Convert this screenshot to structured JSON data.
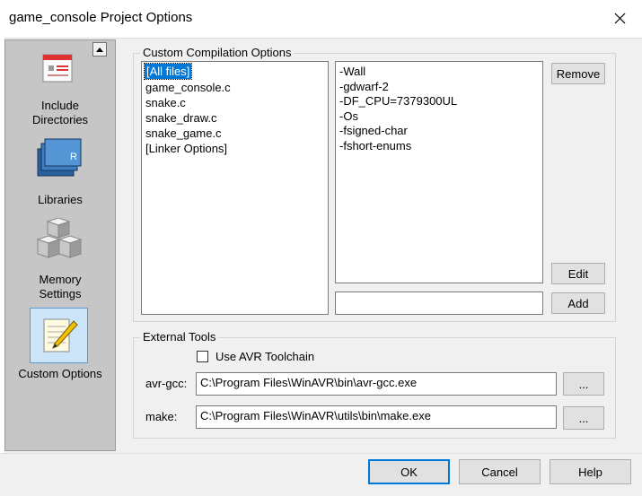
{
  "window": {
    "title": "game_console Project Options"
  },
  "sidebar": {
    "items": [
      {
        "label_line1": "Include",
        "label_line2": "Directories",
        "icon": "include-directories-icon"
      },
      {
        "label_line1": "Libraries",
        "icon": "libraries-books-icon"
      },
      {
        "label_line1": "Memory",
        "label_line2": "Settings",
        "icon": "memory-cubes-icon"
      },
      {
        "label_line1": "Custom Options",
        "icon": "custom-options-notepad-icon"
      }
    ]
  },
  "custom": {
    "group_label": "Custom Compilation Options",
    "files": [
      "[All files]",
      "game_console.c",
      "snake.c",
      "snake_draw.c",
      "snake_game.c",
      "[Linker Options]"
    ],
    "options": [
      "-Wall",
      "-gdwarf-2",
      "-DF_CPU=7379300UL",
      "-Os",
      "-fsigned-char",
      "-fshort-enums"
    ],
    "remove_label": "Remove",
    "edit_label": "Edit",
    "add_label": "Add",
    "new_option_value": ""
  },
  "external": {
    "group_label": "External Tools",
    "use_avr_label": "Use AVR Toolchain",
    "avrgcc_label": "avr-gcc:",
    "avrgcc_path": "C:\\Program Files\\WinAVR\\bin\\avr-gcc.exe",
    "make_label": "make:",
    "make_path": "C:\\Program Files\\WinAVR\\utils\\bin\\make.exe",
    "browse_label": "..."
  },
  "buttons": {
    "ok": "OK",
    "cancel": "Cancel",
    "help": "Help"
  }
}
